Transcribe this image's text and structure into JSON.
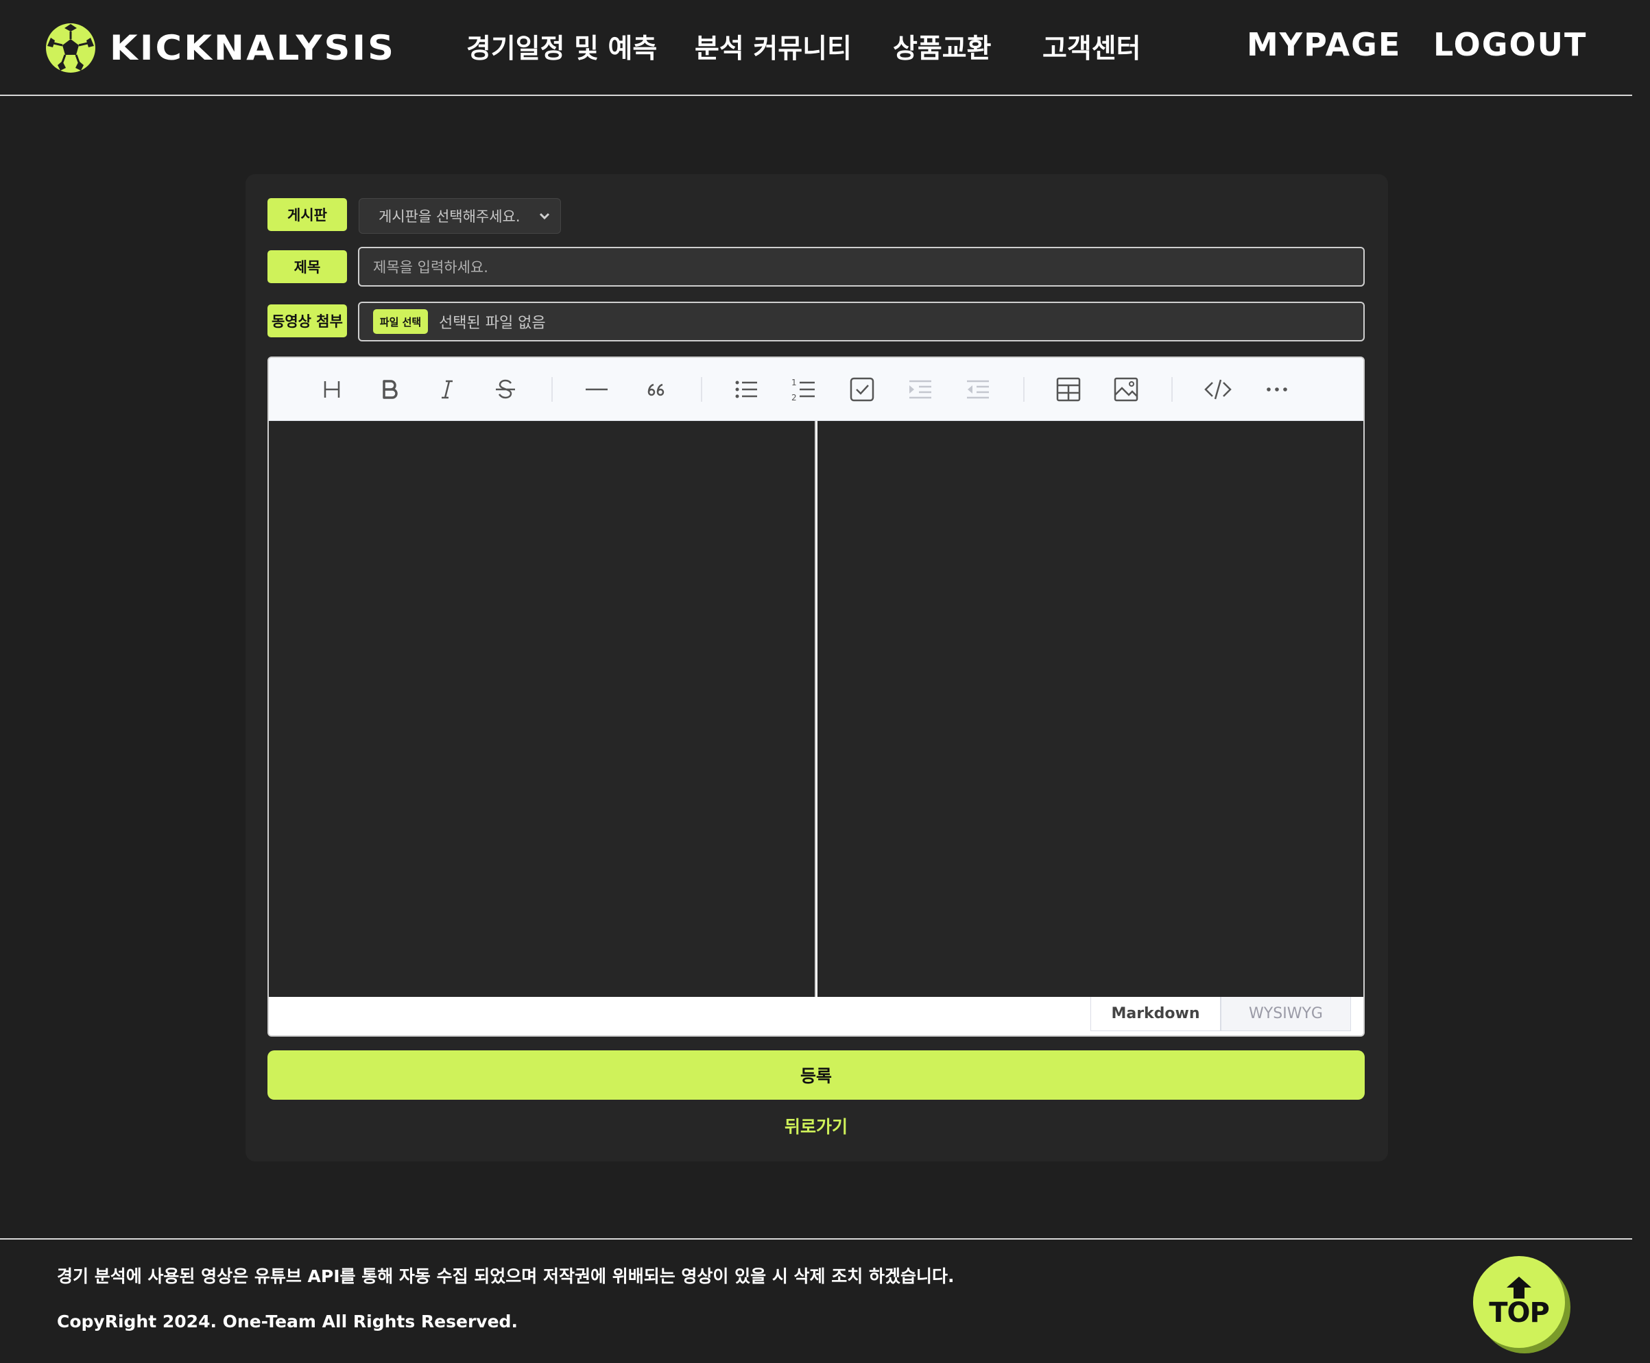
{
  "header": {
    "logo_text": "KICKNALYSIS",
    "nav": [
      {
        "label": "경기일정 및 예측"
      },
      {
        "label": "분석 커뮤니티"
      },
      {
        "label": "상품교환"
      },
      {
        "label": "고객센터"
      }
    ],
    "account": {
      "mypage": "MYPAGE",
      "logout": "LOGOUT"
    }
  },
  "form": {
    "board_label": "게시판",
    "board_select_value": "게시판을 선택해주세요.",
    "title_label": "제목",
    "title_placeholder": "제목을 입력하세요.",
    "video_label": "동영상 첨부",
    "file_button": "파일 선택",
    "file_status": "선택된 파일 없음"
  },
  "editor": {
    "toolbar": [
      "heading-icon",
      "bold-icon",
      "italic-icon",
      "strike-icon",
      "hr-icon",
      "quote-icon",
      "bullet-list-icon",
      "ordered-list-icon",
      "task-list-icon",
      "indent-icon",
      "outdent-icon",
      "table-icon",
      "image-icon",
      "code-icon",
      "more-icon"
    ],
    "modes": {
      "markdown": "Markdown",
      "wysiwyg": "WYSIWYG"
    }
  },
  "actions": {
    "submit": "등록",
    "back": "뒤로가기"
  },
  "footer": {
    "notice": "경기 분석에 사용된 영상은 유튜브 API를 통해 자동 수집 되었으며 저작권에 위배되는 영상이 있을 시 삭제 조치 하겠습니다.",
    "copyright": "CopyRight 2024. One-Team All Rights Reserved.",
    "top_label": "TOP"
  },
  "colors": {
    "accent": "#cff25a",
    "background": "#1f1f1f",
    "card": "#262626"
  }
}
